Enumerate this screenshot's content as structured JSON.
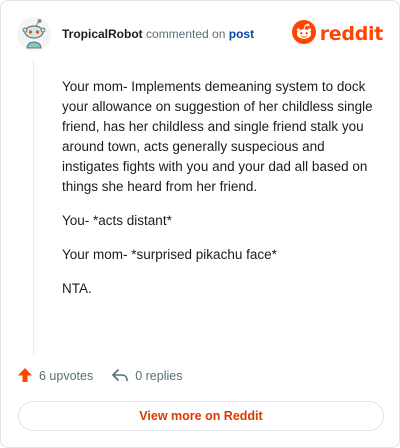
{
  "header": {
    "username": "TropicalRobot",
    "verb": "commented on",
    "post_link": "post",
    "brand_name": "reddit",
    "brand_color": "#ff4500",
    "avatar_icon": "snoo-avatar-icon"
  },
  "comment": {
    "paragraphs": [
      "Your mom- Implements demeaning system to dock your allowance on suggestion of her childless single friend, has her childless and single friend stalk you around town, acts generally suspecious and instigates fights with you and your dad all based on things she heard from her friend.",
      "You- *acts distant*",
      "Your mom- *surprised pikachu face*",
      "NTA."
    ]
  },
  "footer": {
    "upvotes": "6 upvotes",
    "replies": "0 replies",
    "upvote_icon": "upvote-arrow-icon",
    "reply_icon": "reply-arrow-icon",
    "view_more": "View more on Reddit"
  }
}
